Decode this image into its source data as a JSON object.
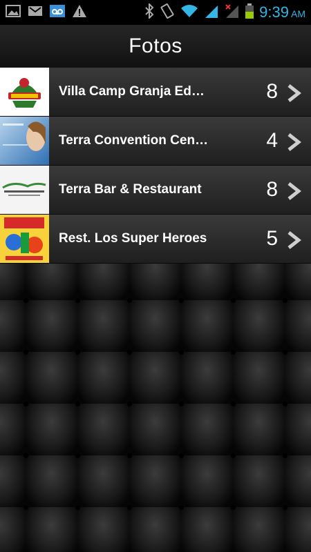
{
  "status_bar": {
    "icons_left": [
      "gallery-icon",
      "gmail-icon",
      "voicemail-icon",
      "warning-icon"
    ],
    "icons_right": [
      "bluetooth-icon",
      "vibrate-icon",
      "wifi-icon",
      "signal-icon",
      "signal-no-data-icon",
      "battery-icon"
    ],
    "time": "9:39",
    "ampm": "AM",
    "accent": "#33b5e5"
  },
  "header": {
    "title": "Fotos"
  },
  "albums": [
    {
      "name": "Villa Camp Granja Edu…",
      "count": "8",
      "thumb": "villa-camp-logo"
    },
    {
      "name": "Terra Convention Center",
      "count": "4",
      "thumb": "terra-convention-photo"
    },
    {
      "name": "Terra Bar & Restaurant",
      "count": "8",
      "thumb": "terra-campestre-logo"
    },
    {
      "name": "Rest. Los Super Heroes",
      "count": "5",
      "thumb": "super-heroes-poster"
    }
  ]
}
